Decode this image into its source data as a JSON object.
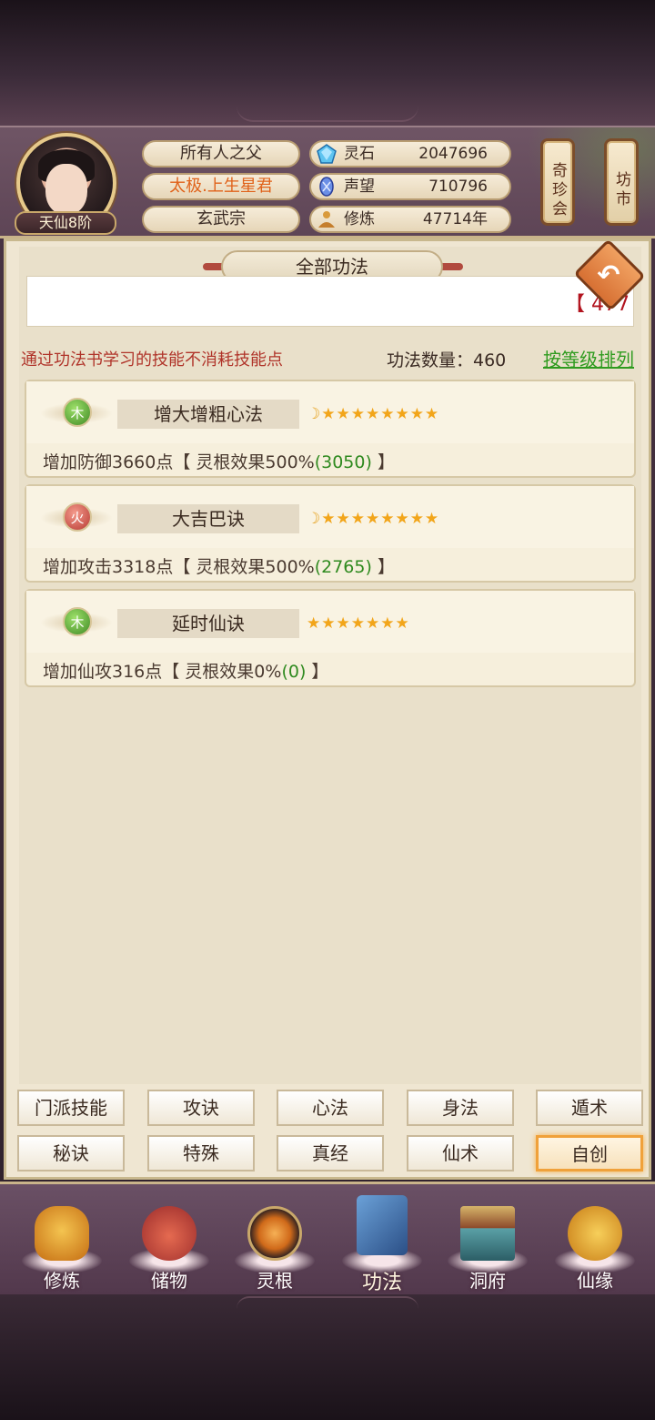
{
  "player": {
    "rank": "天仙8阶",
    "title": "所有人之父",
    "honor": "太极.上生星君",
    "sect": "玄武宗"
  },
  "resources": [
    {
      "icon": "spirit-stone-icon",
      "label": "灵石",
      "value": "2047696"
    },
    {
      "icon": "reputation-icon",
      "label": "声望",
      "value": "710796"
    },
    {
      "icon": "cultivation-icon",
      "label": "修炼",
      "value": "47714年"
    }
  ],
  "side_buttons": {
    "treasure": "奇珍会",
    "market": "坊市"
  },
  "panel": {
    "title": "全部功法",
    "notice": "【 477",
    "hint": "通过功法书学习的技能不消耗技能点",
    "count": "功法数量：460",
    "sort": "按等级排列"
  },
  "skills": [
    {
      "element": "木",
      "element_type": "wood",
      "name": "增大增粗心法",
      "moons": 1,
      "stars": 8,
      "desc_prefix": "增加防御3660点【 灵根效果500%",
      "desc_green": "(3050)",
      "desc_suffix": " 】"
    },
    {
      "element": "火",
      "element_type": "fire",
      "name": "大吉巴诀",
      "moons": 1,
      "stars": 8,
      "desc_prefix": "增加攻击3318点【 灵根效果500%",
      "desc_green": "(2765)",
      "desc_suffix": " 】"
    },
    {
      "element": "木",
      "element_type": "wood",
      "name": "延时仙诀",
      "moons": 0,
      "stars": 7,
      "desc_prefix": "增加仙攻316点【 灵根效果0%",
      "desc_green": "(0)",
      "desc_suffix": " 】"
    }
  ],
  "categories": [
    {
      "label": "门派技能",
      "active": false
    },
    {
      "label": "攻诀",
      "active": false
    },
    {
      "label": "心法",
      "active": false
    },
    {
      "label": "身法",
      "active": false
    },
    {
      "label": "遁术",
      "active": false
    },
    {
      "label": "秘诀",
      "active": false
    },
    {
      "label": "特殊",
      "active": false
    },
    {
      "label": "真经",
      "active": false
    },
    {
      "label": "仙术",
      "active": false
    },
    {
      "label": "自创",
      "active": true
    }
  ],
  "nav": [
    {
      "label": "修炼",
      "icon": "meditating-monk-icon",
      "active": false
    },
    {
      "label": "储物",
      "icon": "storage-bag-icon",
      "active": false
    },
    {
      "label": "灵根",
      "icon": "spirit-root-icon",
      "active": false
    },
    {
      "label": "功法",
      "icon": "skill-book-icon",
      "active": true
    },
    {
      "label": "洞府",
      "icon": "cave-mansion-icon",
      "active": false
    },
    {
      "label": "仙缘",
      "icon": "gourd-icon",
      "active": false
    }
  ],
  "colors": {
    "accent": "#f0a13a",
    "green": "#2f8a1f",
    "red": "#b0342a"
  }
}
